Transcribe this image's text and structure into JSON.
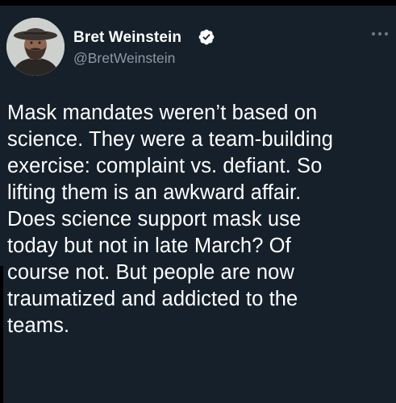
{
  "author": {
    "display_name": "Bret Weinstein",
    "handle": "@BretWeinstein",
    "verified": true,
    "avatar_icon": "profile-photo-man-with-hat"
  },
  "tweet": {
    "text": "Mask mandates weren’t based on\nscience. They were a team-building\nexercise: complaint vs. defiant. So\nlifting them is an awkward affair.\nDoes science support mask use\ntoday but not in late March? Of\ncourse not. But people are now\ntraumatized and addicted to the\nteams."
  },
  "icons": {
    "verified": "verified-badge-icon",
    "more": "more-options-icon"
  },
  "colors": {
    "background": "#15202b",
    "text": "#ffffff",
    "secondary_text": "#8b98a5",
    "verified_badge": "#ffffff"
  }
}
